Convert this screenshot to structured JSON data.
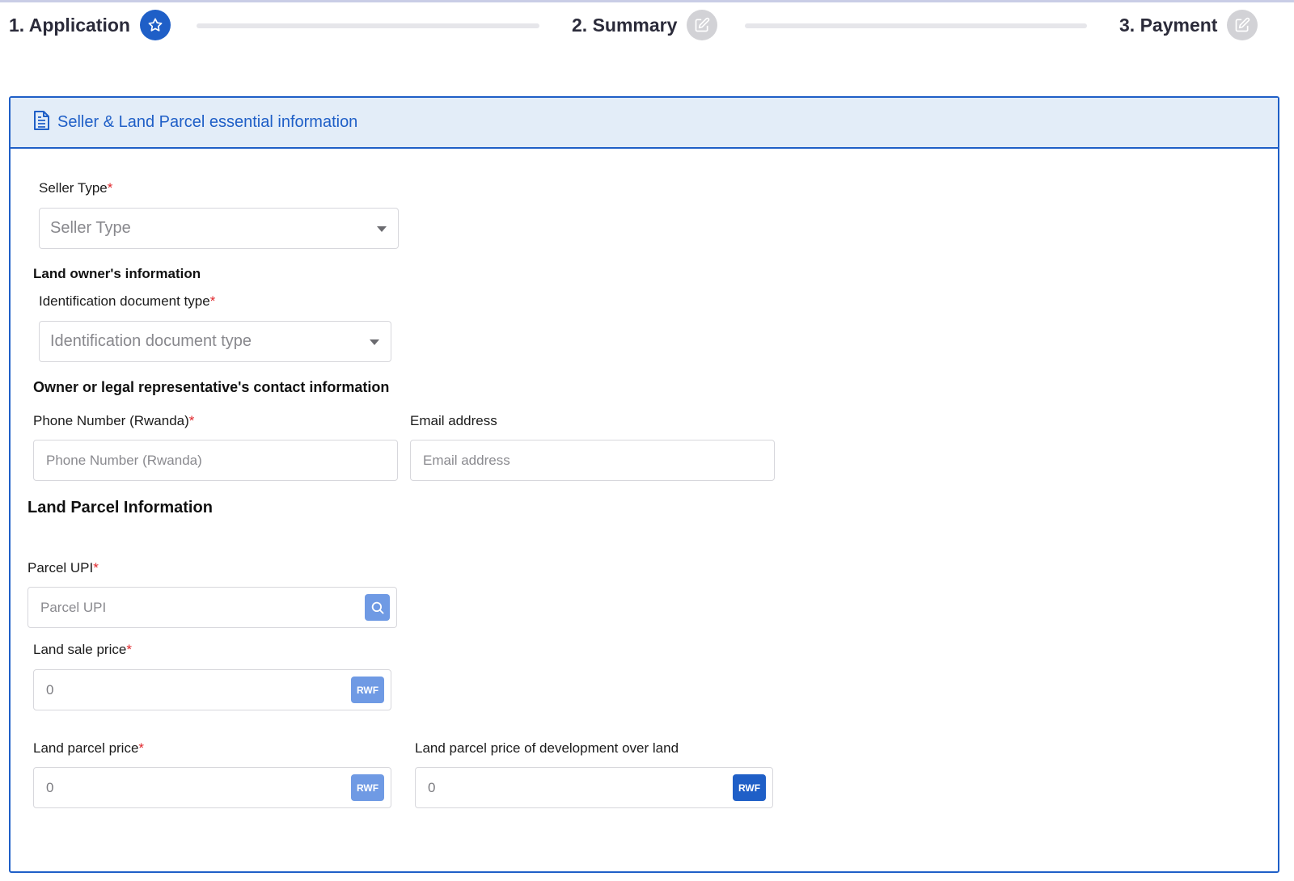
{
  "stepper": {
    "steps": [
      {
        "label": "1. Application",
        "icon": "star-icon",
        "state": "active"
      },
      {
        "label": "2. Summary",
        "icon": "edit-icon",
        "state": "inactive"
      },
      {
        "label": "3. Payment",
        "icon": "edit-icon",
        "state": "inactive"
      }
    ]
  },
  "card": {
    "title": "Seller & Land Parcel essential information",
    "icon": "document-icon"
  },
  "form": {
    "seller_type": {
      "label": "Seller Type",
      "required": "*",
      "placeholder": "Seller Type"
    },
    "land_owner_heading": "Land owner's information",
    "id_doc_type": {
      "label": "Identification document type",
      "required": "*",
      "placeholder": "Identification document type"
    },
    "contact_heading": "Owner or legal representative's contact information",
    "phone": {
      "label": "Phone Number (Rwanda)",
      "required": "*",
      "placeholder": "Phone Number (Rwanda)"
    },
    "email": {
      "label": "Email address",
      "placeholder": "Email address"
    },
    "parcel_heading": "Land Parcel Information",
    "parcel_upi": {
      "label": "Parcel UPI",
      "required": "*",
      "placeholder": "Parcel UPI",
      "button_icon": "search-icon"
    },
    "land_sale_price": {
      "label": "Land sale price",
      "required": "*",
      "value": "0",
      "currency": "RWF"
    },
    "land_parcel_price": {
      "label": "Land parcel price",
      "required": "*",
      "value": "0",
      "currency": "RWF"
    },
    "development_price": {
      "label": "Land parcel price of development over land",
      "value": "0",
      "currency": "RWF"
    }
  },
  "colors": {
    "accent": "#1f5fc7",
    "header_bg": "#e3edf8",
    "required": "#e0262b",
    "addon_light": "#6f9ae4"
  }
}
